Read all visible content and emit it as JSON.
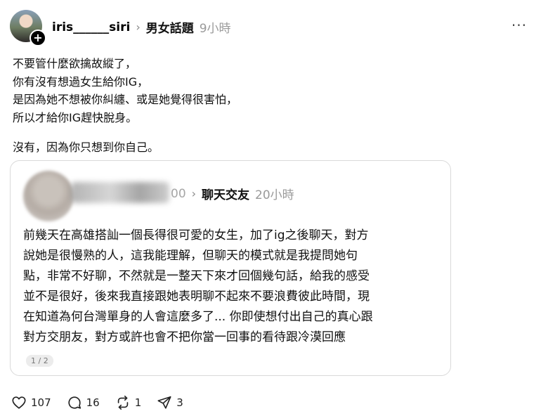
{
  "post": {
    "username": "iris______siri",
    "topic": "男女話題",
    "time": "9小時",
    "more_label": "···",
    "body_lines": [
      "不要管什麼欲擒故縱了，",
      "你有沒有想過女生給你IG，",
      "是因為她不想被你糾纏、或是她覺得很害怕，",
      "所以才給你IG趕快脫身。"
    ],
    "reply": "沒有，因為你只想到你自己。"
  },
  "quoted": {
    "username_tail": "00",
    "topic": "聊天交友",
    "time": "20小時",
    "body_lines": [
      "前幾天在高雄搭訕一個長得很可愛的女生，加了ig之後聊天，對方",
      "說她是很慢熟的人，這我能理解，但聊天的模式就是我提問她句",
      "點，非常不好聊，不然就是一整天下來才回個幾句話，給我的感受",
      "並不是很好，後來我直接跟她表明聊不起來不要浪費彼此時間，現",
      "在知道為何台灣單身的人會這麼多了... 你即使想付出自己的真心跟",
      "對方交朋友，對方或許也會不把你當一回事的看待跟冷漠回應"
    ],
    "page_indicator": "1 / 2"
  },
  "actions": {
    "likes": "107",
    "comments": "16",
    "reposts": "1",
    "shares": "3"
  },
  "icons": {
    "like": "heart-icon",
    "comment": "comment-bubble-icon",
    "repost": "repost-icon",
    "share": "send-icon",
    "follow": "plus-icon",
    "chevron": "chevron-right-icon"
  }
}
